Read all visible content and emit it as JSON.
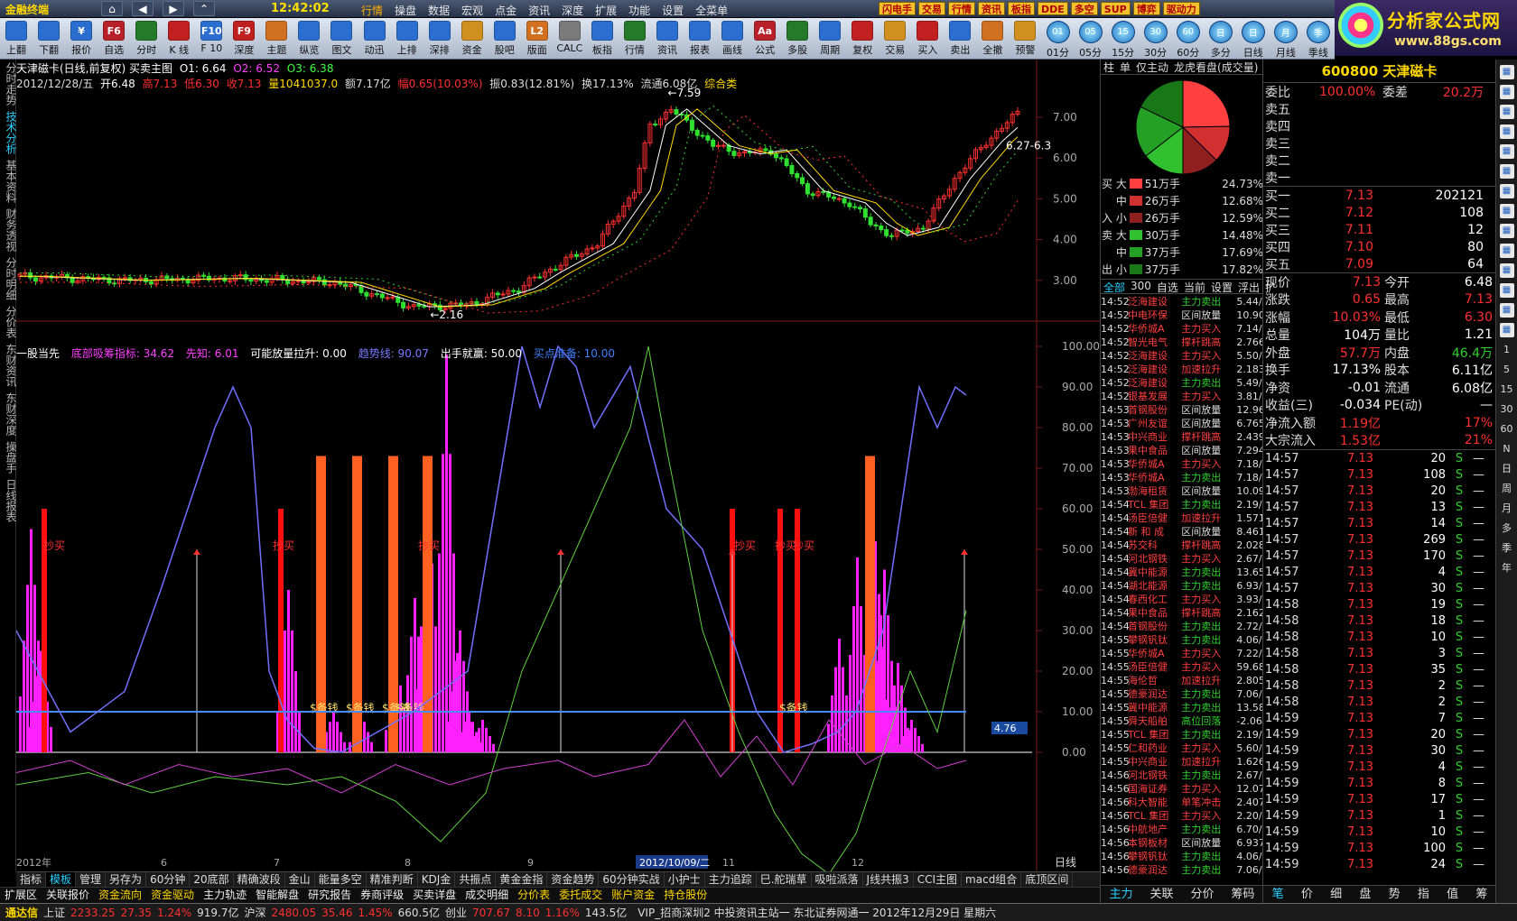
{
  "titlebar": {
    "app": "金融终端",
    "clock": "12:42:02",
    "nav": [
      "行情",
      "操盘",
      "数据",
      "宏观",
      "点金",
      "资讯",
      "深度",
      "扩展",
      "功能",
      "设置",
      "全菜单"
    ],
    "badges": [
      "闪电手",
      "交易",
      "行情",
      "资讯",
      "板指",
      "DDE",
      "多空",
      "SUP",
      "博弈",
      "驱动力"
    ]
  },
  "brand": {
    "title": "分析家公式网",
    "url": "www.88gs.com"
  },
  "toolbar": [
    {
      "l": "上翻",
      "c": "#2a6fd0"
    },
    {
      "l": "下翻",
      "c": "#2a6fd0"
    },
    {
      "l": "报价",
      "c": "#2a6fd0",
      "i": "¥"
    },
    {
      "l": "自选",
      "c": "#b8202a",
      "i": "F6"
    },
    {
      "l": "分时",
      "c": "#257a2a"
    },
    {
      "l": "K 线",
      "c": "#c02020"
    },
    {
      "l": "F 10",
      "c": "#2a6fd0",
      "i": "F10"
    },
    {
      "l": "深度",
      "c": "#c02020",
      "i": "F9"
    },
    {
      "l": "主题",
      "c": "#d07020"
    },
    {
      "l": "纵览",
      "c": "#2a6fd0"
    },
    {
      "l": "图文",
      "c": "#2a6fd0"
    },
    {
      "l": "动迅",
      "c": "#2a6fd0"
    },
    {
      "l": "上排",
      "c": "#2a6fd0"
    },
    {
      "l": "深排",
      "c": "#2a6fd0"
    },
    {
      "l": "资金",
      "c": "#d09020"
    },
    {
      "l": "股吧",
      "c": "#2a6fd0"
    },
    {
      "l": "版面",
      "c": "#d07020",
      "i": "L2"
    },
    {
      "l": "CALC",
      "c": "#7a7a7a"
    },
    {
      "l": "板指",
      "c": "#2a6fd0"
    },
    {
      "l": "行情",
      "c": "#257a2a"
    },
    {
      "l": "资讯",
      "c": "#2a6fd0"
    },
    {
      "l": "报表",
      "c": "#2a6fd0"
    },
    {
      "l": "画线",
      "c": "#2a6fd0"
    },
    {
      "l": "公式",
      "c": "#b8202a",
      "i": "Aa"
    },
    {
      "l": "多股",
      "c": "#257a2a"
    },
    {
      "l": "周期",
      "c": "#2a6fd0"
    },
    {
      "l": "复权",
      "c": "#c02020"
    },
    {
      "l": "交易",
      "c": "#d09020"
    },
    {
      "l": "买入",
      "c": "#c02020"
    },
    {
      "l": "卖出",
      "c": "#2a6fd0"
    },
    {
      "l": "全撤",
      "c": "#d07020"
    },
    {
      "l": "预警",
      "c": "#d09020"
    },
    {
      "l": "01分",
      "circ": "01"
    },
    {
      "l": "05分",
      "circ": "05"
    },
    {
      "l": "15分",
      "circ": "15"
    },
    {
      "l": "30分",
      "circ": "30"
    },
    {
      "l": "60分",
      "circ": "60"
    },
    {
      "l": "多分",
      "circ": "日"
    },
    {
      "l": "日线",
      "circ": "日"
    },
    {
      "l": "月线",
      "circ": "月"
    },
    {
      "l": "季线",
      "circ": "季"
    }
  ],
  "lefttabs": [
    "分时走势",
    "技术分析",
    "基本资料",
    "财务透视",
    "分时明细",
    "分价表",
    "东财资讯",
    "东财深度",
    "操盘手",
    "日线报表"
  ],
  "quote": {
    "name": "天津磁卡(日线,前复权) 买卖主图",
    "o1": "O1: 6.64",
    "o2": "O2: 6.52",
    "o3": "O3: 6.38",
    "date": "2012/12/28/五",
    "open": "开6.48",
    "high": "高7.13",
    "low": "低6.30",
    "close": "收7.13",
    "vol": "量1041037.0",
    "amt": "额7.17亿",
    "chg": "幅0.65(10.03%)",
    "amp": "振0.83(12.81%)",
    "turn": "换17.13%",
    "float": "流通6.08亿",
    "cat": "综合类"
  },
  "indicator": {
    "name": "一股当先",
    "a": "底部吸筹指标: 34.62",
    "b": "先知: 6.01",
    "c": "可能放量拉升: 0.00",
    "d": "趋势线: 90.07",
    "e": "出手就赢: 50.00",
    "f": "买点准备: 10.00"
  },
  "chart_data": {
    "type": "candlestick+indicator",
    "price_axis": {
      "ticks": [
        "7.00",
        "6.00",
        "5.00",
        "4.00",
        "3.00"
      ]
    },
    "price_labels": {
      "high": "7.59",
      "low": "2.16",
      "last": "6.27-6.3"
    },
    "indicator_axis": {
      "ticks": [
        "100.00",
        "90.00",
        "80.00",
        "70.00",
        "60.00",
        "50.00",
        "40.00",
        "30.00",
        "20.00",
        "10.00",
        "0.00"
      ],
      "current": "4.76"
    },
    "x_labels": [
      "2012年",
      "6",
      "7",
      "8",
      "9",
      "2012/10/09/二",
      "11",
      "12"
    ],
    "signal_labels": {
      "buy": "抄买",
      "ready": "$备钱"
    },
    "right_tab": "日线"
  },
  "bottomtabs": [
    "指标",
    "模板",
    "管理",
    "另存为",
    "60分钟",
    "20底部",
    "精确波段",
    "金山",
    "能量多空",
    "精准判断",
    "KDJ金",
    "共振点",
    "黄金金指",
    "资金趋势",
    "60分钟实战",
    "小护士",
    "主力追踪",
    "巳.舵瑞草",
    "吸啦派落",
    "J线共振3",
    "CCI主图",
    "macd组合",
    "底顶区间"
  ],
  "bottomtabs2": [
    "扩展区",
    "关联报价",
    "资金流向",
    "资金驱动",
    "主力轨迹",
    "智能解盘",
    "研究报告",
    "券商评级",
    "买卖详盘",
    "成交明细",
    "分价表",
    "委托成交",
    "账户资金",
    "持仓股份"
  ],
  "statusbar": {
    "brand": "通达信",
    "sh": "上证",
    "sh_v": "2233.25",
    "sh_c": "27.35",
    "sh_p": "1.24%",
    "sh_a": "919.7亿",
    "sz": "沪深",
    "sz_v": "2480.05",
    "sz_c": "35.46",
    "sz_p": "1.45%",
    "sz_a": "660.5亿",
    "cy": "创业",
    "cy_v": "707.67",
    "cy_c": "8.10",
    "cy_p": "1.16%",
    "cy_a": "143.5亿",
    "news": "VIP_招商深圳2  中投资讯主站一  东北证券网通一  2012年12月29日  星期六"
  },
  "midtabs": [
    "柱",
    "单",
    "仅主动",
    "龙虎看盘(成交量)"
  ],
  "flow": [
    {
      "s": "买",
      "z": "大",
      "c": "#ff4040",
      "a": "51万手",
      "p": "24.73%"
    },
    {
      "s": "",
      "z": "中",
      "c": "#d03030",
      "a": "26万手",
      "p": "12.68%"
    },
    {
      "s": "入",
      "z": "小",
      "c": "#902020",
      "a": "26万手",
      "p": "12.59%"
    },
    {
      "s": "卖",
      "z": "大",
      "c": "#30c030",
      "a": "30万手",
      "p": "14.48%"
    },
    {
      "s": "",
      "z": "中",
      "c": "#24a024",
      "a": "37万手",
      "p": "17.69%"
    },
    {
      "s": "出",
      "z": "小",
      "c": "#187818",
      "a": "37万手",
      "p": "17.82%"
    }
  ],
  "dealtabs": [
    "全部",
    "300",
    "自选",
    "当前",
    "设置",
    "浮出",
    "扩"
  ],
  "deals": [
    [
      "14:52",
      "泛海建设",
      "主力卖出",
      "5.44/5"
    ],
    [
      "14:52",
      "中电环保",
      "区间放量",
      "10.903"
    ],
    [
      "14:52",
      "华侨城A",
      "主力买入",
      "7.14/5"
    ],
    [
      "14:52",
      "智光电气",
      "撑杆跳高",
      "2.766"
    ],
    [
      "14:52",
      "泛海建设",
      "主力买入",
      "5.50/3"
    ],
    [
      "14:52",
      "泛海建设",
      "加速拉升",
      "2.183"
    ],
    [
      "14:52",
      "泛海建设",
      "主力卖出",
      "5.49/3"
    ],
    [
      "14:52",
      "银基发展",
      "主力买入",
      "3.81/3"
    ],
    [
      "14:53",
      "首钢股份",
      "区间放量",
      "12.960"
    ],
    [
      "14:53",
      "广州友谊",
      "区间放量",
      "6.765"
    ],
    [
      "14:53",
      "中兴商业",
      "撑杆跳高",
      "2.439"
    ],
    [
      "14:53",
      "果中食品",
      "区间放量",
      "7.294"
    ],
    [
      "14:53",
      "华侨城A",
      "主力买入",
      "7.18/4"
    ],
    [
      "14:53",
      "华侨城A",
      "主力卖出",
      "7.18/5"
    ],
    [
      "14:53",
      "渤海租赁",
      "区间放量",
      "10.090"
    ],
    [
      "14:54",
      "TCL 集团",
      "主力卖出",
      "2.19/1"
    ],
    [
      "14:54",
      "汤臣倍健",
      "加速拉升",
      "1.571"
    ],
    [
      "14:54",
      "新 和 成",
      "区间放量",
      "8.461"
    ],
    [
      "14:54",
      "苏交科",
      "撑杆跳高",
      "2.028"
    ],
    [
      "14:54",
      "河北钢铁",
      "主力买入",
      "2.67/3"
    ],
    [
      "14:54",
      "冀中能源",
      "主力卖出",
      "13.65"
    ],
    [
      "14:54",
      "湖北能源",
      "主力卖出",
      "6.93/3"
    ],
    [
      "14:54",
      "春西化工",
      "主力买入",
      "3.93/3"
    ],
    [
      "14:54",
      "果中食品",
      "撑杆跳高",
      "2.162"
    ],
    [
      "14:54",
      "首钢股份",
      "主力卖出",
      "2.72/2"
    ],
    [
      "14:55",
      "攀钢钒钛",
      "主力卖出",
      "4.06/1"
    ],
    [
      "14:55",
      "华侨城A",
      "主力买入",
      "7.22/2"
    ],
    [
      "14:55",
      "汤臣倍健",
      "主力买入",
      "59.68/"
    ],
    [
      "14:55",
      "海伦哲",
      "加速拉升",
      "2.805"
    ],
    [
      "14:55",
      "德豪润达",
      "主力卖出",
      "7.06/3"
    ],
    [
      "14:55",
      "冀中能源",
      "主力卖出",
      "13.58/"
    ],
    [
      "14:55",
      "舜天船舶",
      "高位回落",
      "-2.066"
    ],
    [
      "14:55",
      "TCL 集团",
      "主力卖出",
      "2.19/1"
    ],
    [
      "14:55",
      "仁和药业",
      "主力买入",
      "5.60/3"
    ],
    [
      "14:55",
      "中兴商业",
      "加速拉升",
      "1.626"
    ],
    [
      "14:56",
      "河北钢铁",
      "主力卖出",
      "2.67/3"
    ],
    [
      "14:56",
      "国海证券",
      "主力买入",
      "12.07/"
    ],
    [
      "14:56",
      "科大智能",
      "单笔冲击",
      "2.407"
    ],
    [
      "14:56",
      "TCL 集团",
      "主力买入",
      "2.20/1"
    ],
    [
      "14:56",
      "中航地产",
      "主力卖出",
      "6.70/5"
    ],
    [
      "14:56",
      "本钢板材",
      "区间放量",
      "6.937"
    ],
    [
      "14:56",
      "攀钢钒钛",
      "主力卖出",
      "4.06/2"
    ],
    [
      "14:56",
      "德豪润达",
      "主力卖出",
      "7.06/2"
    ]
  ],
  "midbottom": [
    "主力",
    "关联",
    "分价",
    "筹码"
  ],
  "right": {
    "title": "600800 天津磁卡",
    "wb": "委比",
    "wb_v": "100.00%",
    "wc": "委差",
    "wc_v": "20.2万",
    "sells": [
      "卖五",
      "卖四",
      "卖三",
      "卖二",
      "卖一"
    ],
    "buys": [
      [
        "买一",
        "7.13",
        "202121"
      ],
      [
        "买二",
        "7.12",
        "108"
      ],
      [
        "买三",
        "7.11",
        "12"
      ],
      [
        "买四",
        "7.10",
        "80"
      ],
      [
        "买五",
        "7.09",
        "64"
      ]
    ],
    "stats": [
      [
        "现价",
        "7.13",
        "今开",
        "6.48"
      ],
      [
        "涨跌",
        "0.65",
        "最高",
        "7.13"
      ],
      [
        "涨幅",
        "10.03%",
        "最低",
        "6.30"
      ],
      [
        "总量",
        "104万",
        "量比",
        "1.21"
      ],
      [
        "外盘",
        "57.7万",
        "内盘",
        "46.4万"
      ],
      [
        "换手",
        "17.13%",
        "股本",
        "6.11亿"
      ],
      [
        "净资",
        "-0.01",
        "流通",
        "6.08亿"
      ],
      [
        "收益(三)",
        "-0.034",
        "PE(动)",
        "—"
      ],
      [
        "净流入额",
        "1.19亿",
        "",
        "17%"
      ],
      [
        "大宗流入",
        "1.53亿",
        "",
        "21%"
      ]
    ],
    "trades": [
      [
        "14:57",
        "7.13",
        "20"
      ],
      [
        "14:57",
        "7.13",
        "108"
      ],
      [
        "14:57",
        "7.13",
        "20"
      ],
      [
        "14:57",
        "7.13",
        "13"
      ],
      [
        "14:57",
        "7.13",
        "14"
      ],
      [
        "14:57",
        "7.13",
        "269"
      ],
      [
        "14:57",
        "7.13",
        "170"
      ],
      [
        "14:57",
        "7.13",
        "4"
      ],
      [
        "14:57",
        "7.13",
        "30"
      ],
      [
        "14:58",
        "7.13",
        "19"
      ],
      [
        "14:58",
        "7.13",
        "18"
      ],
      [
        "14:58",
        "7.13",
        "10"
      ],
      [
        "14:58",
        "7.13",
        "3"
      ],
      [
        "14:58",
        "7.13",
        "35"
      ],
      [
        "14:58",
        "7.13",
        "2"
      ],
      [
        "14:58",
        "7.13",
        "2"
      ],
      [
        "14:59",
        "7.13",
        "7"
      ],
      [
        "14:59",
        "7.13",
        "20"
      ],
      [
        "14:59",
        "7.13",
        "30"
      ],
      [
        "14:59",
        "7.13",
        "4"
      ],
      [
        "14:59",
        "7.13",
        "8"
      ],
      [
        "14:59",
        "7.13",
        "17"
      ],
      [
        "14:59",
        "7.13",
        "1"
      ],
      [
        "14:59",
        "7.13",
        "10"
      ],
      [
        "14:59",
        "7.13",
        "100"
      ],
      [
        "14:59",
        "7.13",
        "24"
      ]
    ],
    "bottom": [
      "笔",
      "价",
      "细",
      "盘",
      "势",
      "指",
      "值",
      "筹"
    ]
  },
  "rightstrip": [
    "1",
    "5",
    "15",
    "30",
    "60",
    "N",
    "日",
    "周",
    "月",
    "多",
    "季",
    "年"
  ]
}
